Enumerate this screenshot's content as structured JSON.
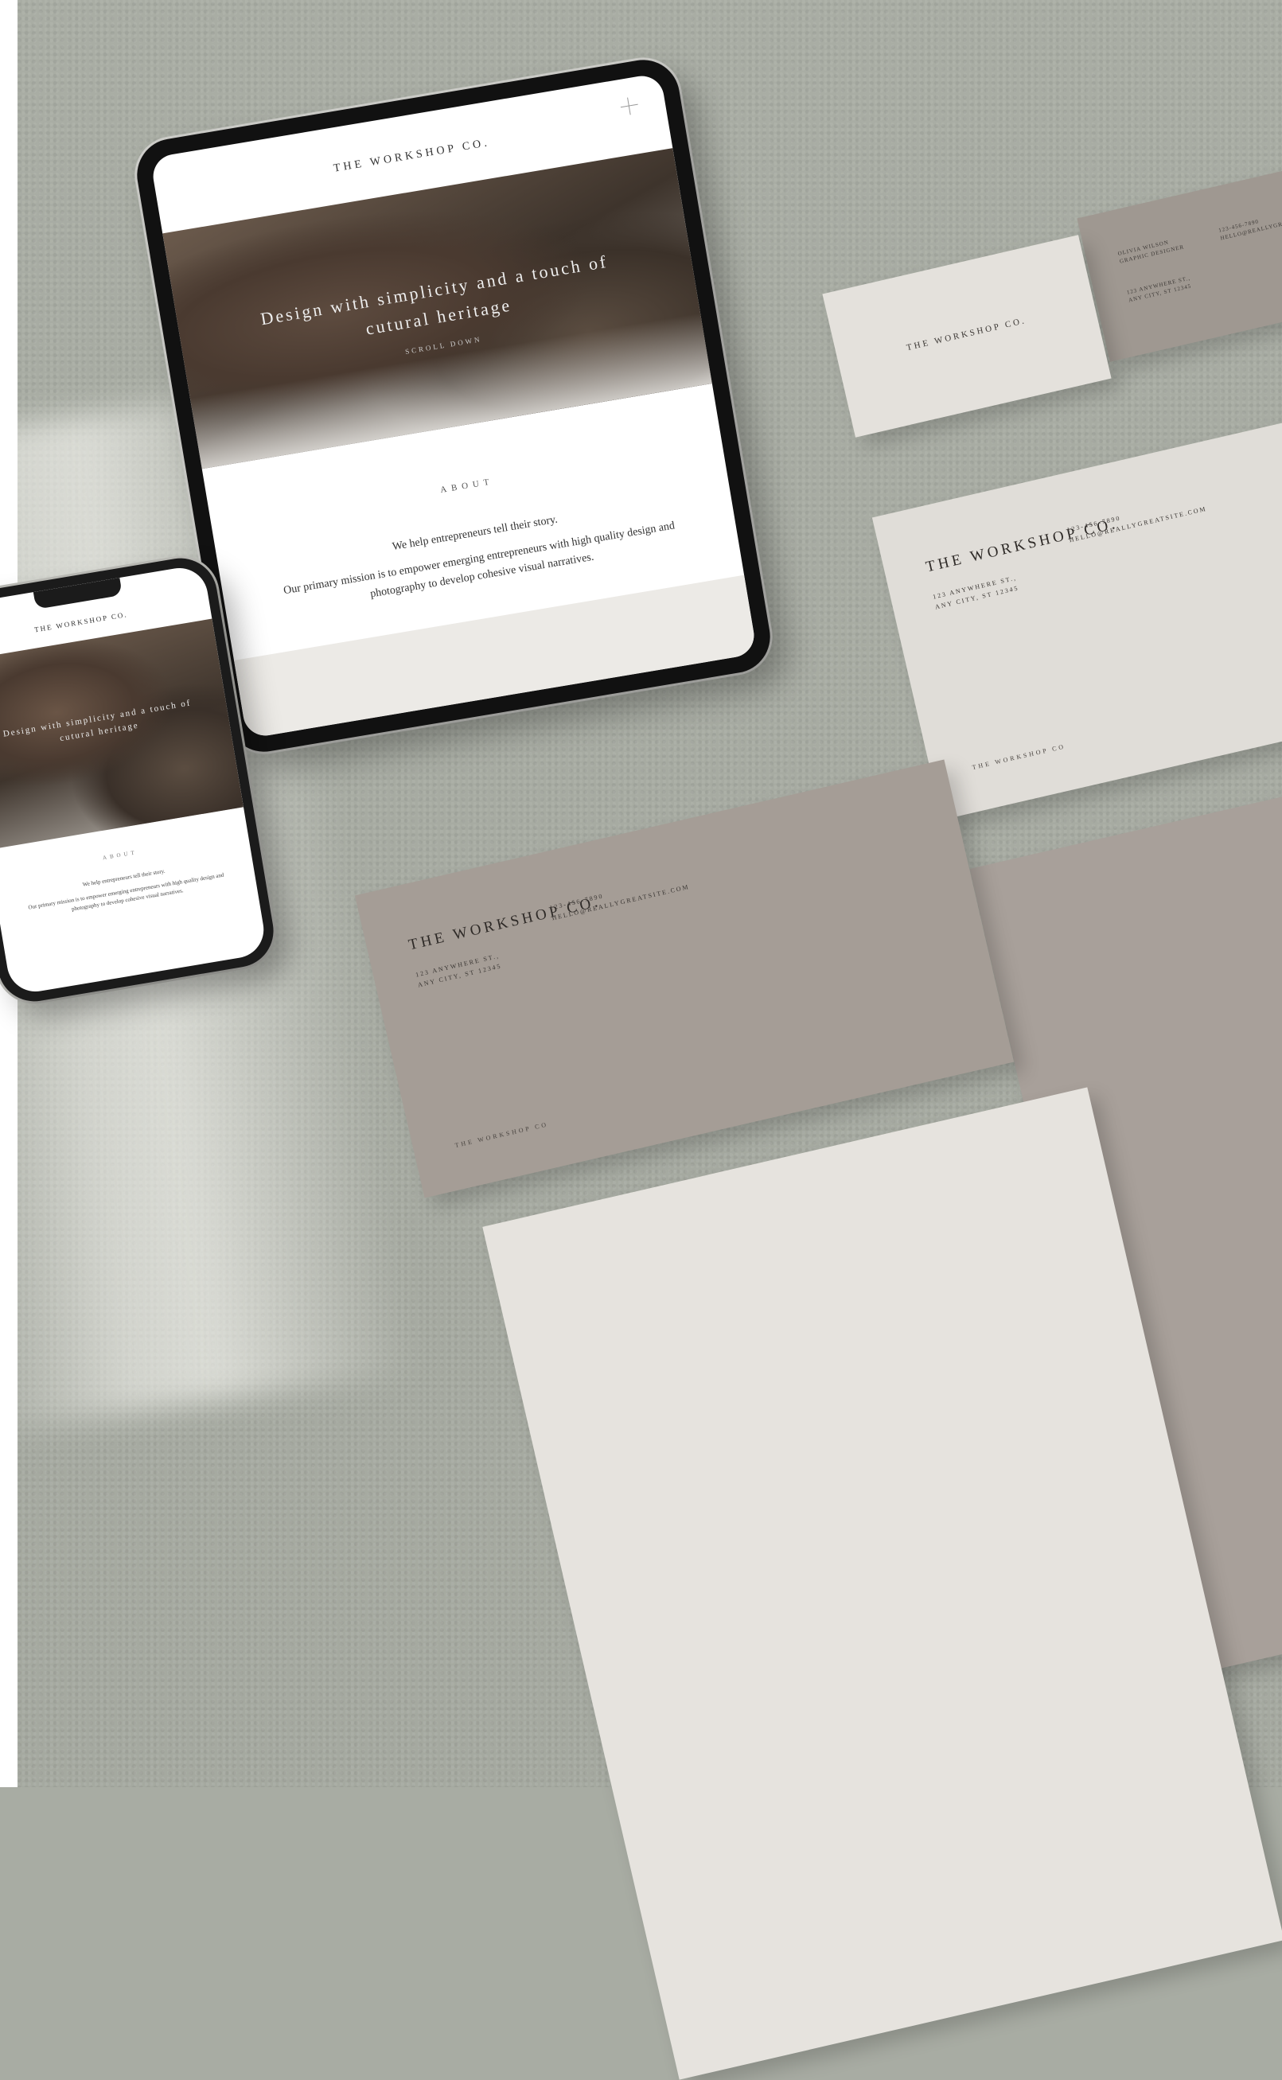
{
  "brand": {
    "name": "THE WORKSHOP CO.",
    "footer_name": "THE WORKSHOP CO"
  },
  "tablet": {
    "headline": "Design with simplicity and a touch of cutural heritage",
    "subtitle": "SCROLL DOWN",
    "about_heading": "ABOUT",
    "about_line1": "We help entrepreneurs tell their story.",
    "about_line2": "Our primary mission is to empower emerging entrepreneurs with high quality design and photography to develop cohesive visual narratives."
  },
  "phone": {
    "headline": "Design with simplicity and a touch of cutural heritage",
    "about_heading": "ABOUT",
    "about_line1": "We help entrepreneurs tell their story.",
    "about_line2": "Our primary mission is to empower emerging entrepreneurs with high quality design and photography to develop cohesive visual narratives."
  },
  "business_card": {
    "name": "OLIVIA WILSON",
    "role": "GRAPHIC DESIGNER",
    "phone": "123-456-7890",
    "email": "HELLO@REALLYGREATSITE.COM",
    "address_line1": "123 ANYWHERE ST.,",
    "address_line2": "ANY CITY, ST 12345"
  },
  "envelope": {
    "address_line1": "123 ANYWHERE ST.,",
    "address_line2": "ANY CITY, ST 12345",
    "phone": "123-456-7890",
    "email": "HELLO@REALLYGREATSITE.COM"
  },
  "colors": {
    "desk": "#a8aca3",
    "paper_light": "#e4e1dc",
    "paper_taupe": "#a59d96",
    "ink": "#2e2a27"
  }
}
